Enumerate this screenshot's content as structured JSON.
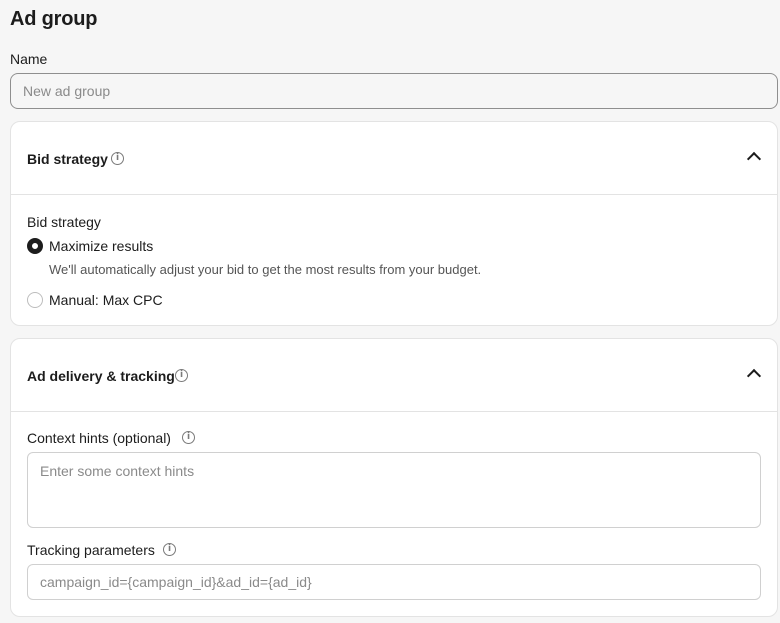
{
  "header": {
    "title": "Ad group"
  },
  "name_field": {
    "label": "Name",
    "placeholder": "New ad group",
    "value": ""
  },
  "bid_strategy": {
    "card_title": "Bid strategy",
    "section_label": "Bid strategy",
    "expanded": true,
    "options": [
      {
        "label": "Maximize results",
        "description": "We'll automatically adjust your bid to get the most results from your budget.",
        "selected": true
      },
      {
        "label": "Manual: Max CPC",
        "selected": false
      }
    ]
  },
  "ad_delivery": {
    "card_title": "Ad delivery & tracking",
    "expanded": true,
    "context_hints": {
      "label": "Context hints (optional)",
      "placeholder": "Enter some context hints",
      "value": ""
    },
    "tracking": {
      "label": "Tracking parameters",
      "placeholder": "campaign_id={campaign_id}&ad_id={ad_id}",
      "value": ""
    }
  },
  "icons": {
    "info": "info-icon",
    "collapse": "chevron-up-icon"
  },
  "colors": {
    "text": "#1c1c1c",
    "muted": "#555555",
    "border": "#e3e3e3",
    "background": "#f6f6f6"
  }
}
